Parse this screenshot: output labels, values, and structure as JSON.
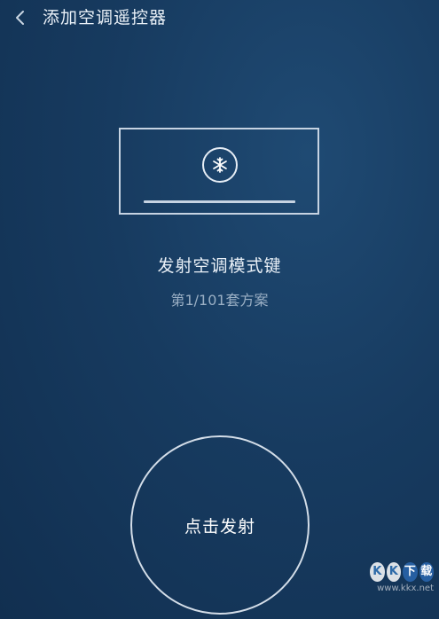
{
  "header": {
    "back_icon": "chevron-left-icon",
    "title": "添加空调遥控器"
  },
  "illustration": {
    "device_icon": "air-conditioner-icon",
    "mode_icon": "snowflake-icon"
  },
  "instruction": {
    "text": "发射空调模式键",
    "plan_counter": "第1/101套方案"
  },
  "send_button": {
    "label": "点击发射"
  },
  "watermark": {
    "badges": [
      "K",
      "K",
      "下",
      "载"
    ],
    "url": "www.kkx.net"
  },
  "colors": {
    "background": "#173b60",
    "outline": "#c6d3e2",
    "secondary_text": "#9aafc4"
  }
}
